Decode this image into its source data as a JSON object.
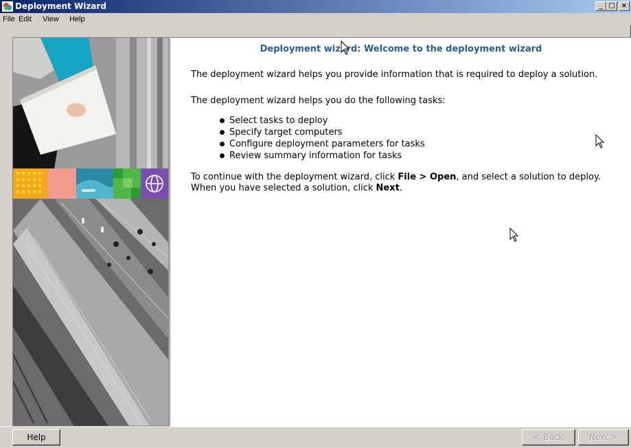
{
  "window": {
    "title": "Deployment Wizard",
    "controls": {
      "minimize": "_",
      "maximize": "□",
      "close": "×"
    }
  },
  "menu": [
    "File",
    "Edit",
    "View",
    "Help"
  ],
  "content": {
    "heading": "Deployment wizard: Welcome to the deployment wizard",
    "intro1": "The deployment wizard helps you provide information that is required to deploy a solution.",
    "intro2": "The deployment wizard helps you do the following tasks:",
    "tasks": [
      "Select tasks to deploy",
      "Specify target computers",
      "Configure deployment parameters for tasks",
      "Review summary information for tasks"
    ],
    "continue": {
      "prefix": "To continue with the deployment wizard, click ",
      "file_open": "File > Open",
      "middle": ", and select a solution to deploy. When you have selected a solution, click ",
      "next": "Next",
      "suffix": "."
    }
  },
  "buttons": {
    "help": "Help",
    "back": "< Back",
    "next": "Next >"
  },
  "colors": {
    "title_gradient_start": "#0a246a",
    "title_gradient_end": "#a6caf0",
    "heading": "#2f5a8a",
    "chrome": "#d4d0c8"
  }
}
